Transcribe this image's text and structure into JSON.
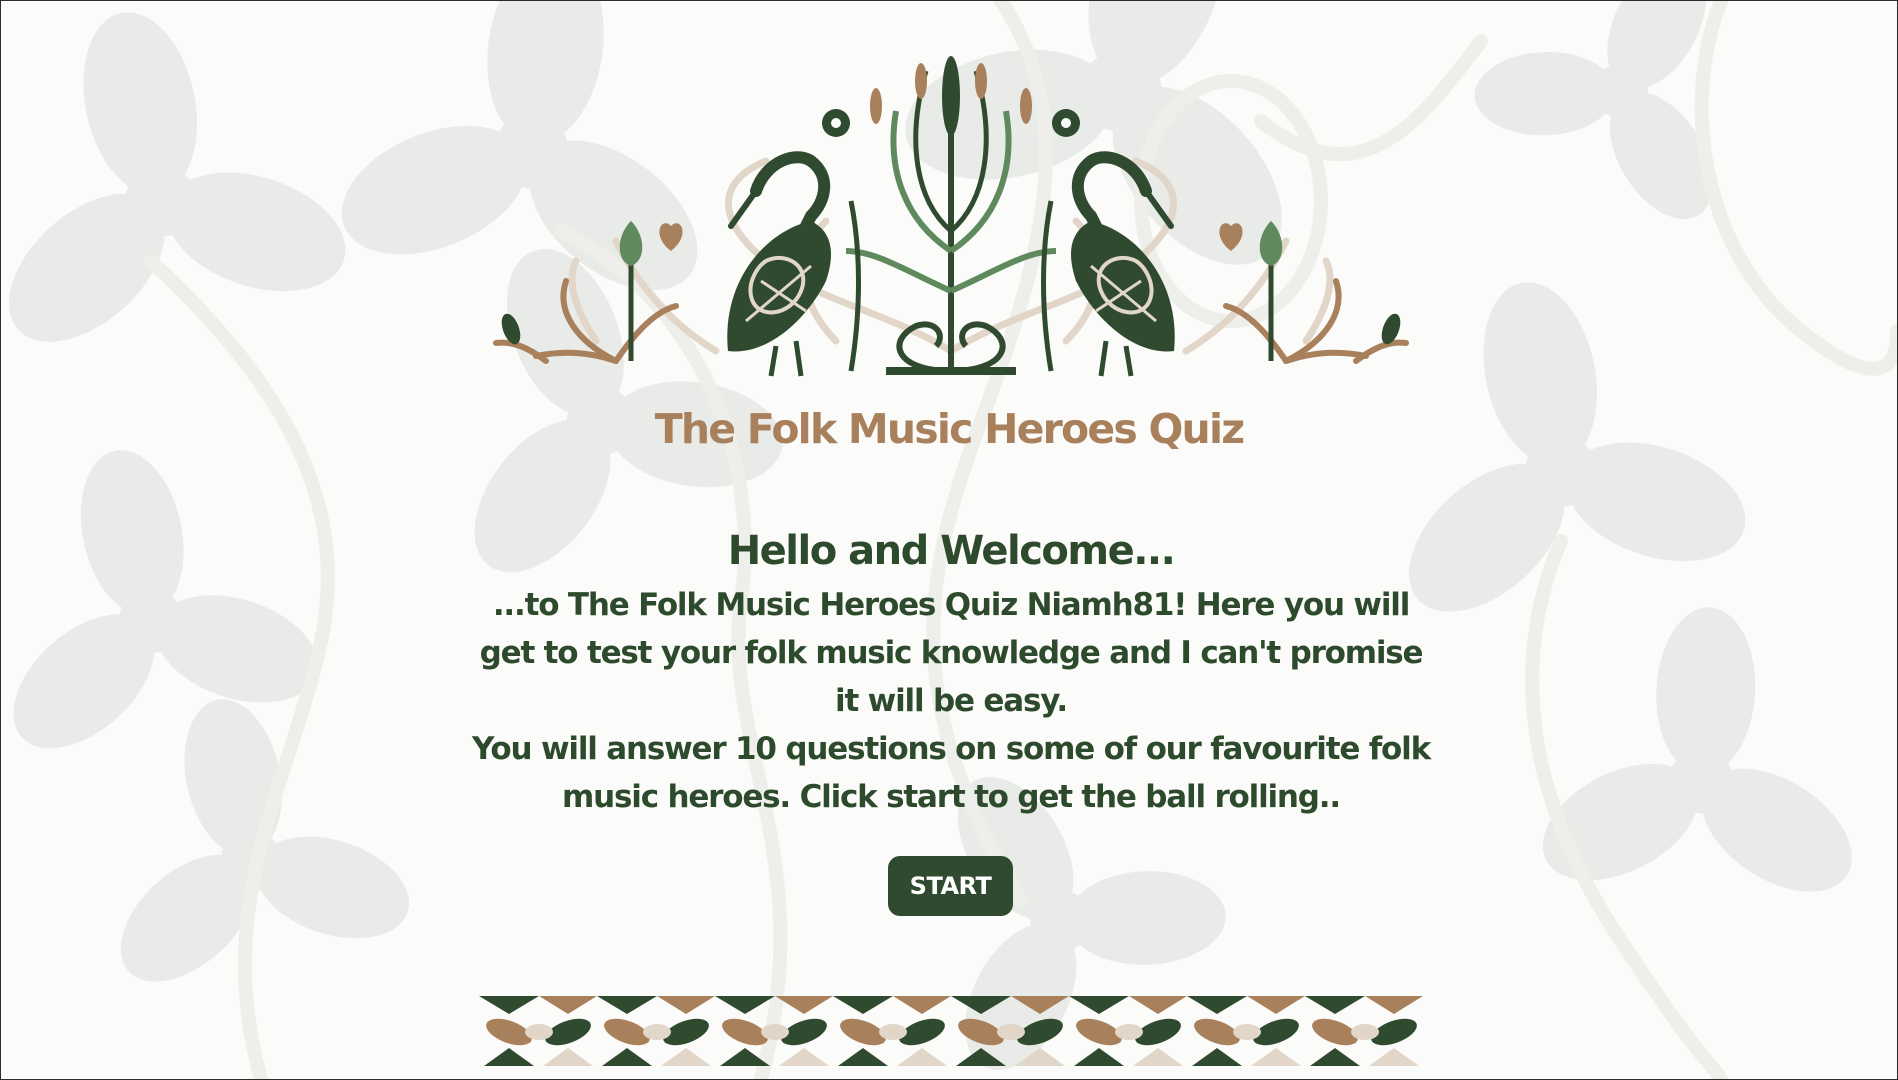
{
  "header": {
    "title": "The Folk Music Heroes Quiz"
  },
  "welcome": {
    "heading": "Hello and Welcome...",
    "intro": "...to The Folk Music Heroes Quiz Niamh81! Here you will get to test your folk music knowledge and I can't promise it will be easy.",
    "instructions": "You will answer 10 questions on some of our favourite folk music heroes. Click start to get the ball rolling.."
  },
  "actions": {
    "start_label": "START"
  },
  "colors": {
    "dark_green": "#2f4a2e",
    "tan": "#a9805c",
    "sage": "#5e8a5e",
    "cream": "#e1d6c8",
    "background_pattern": "#e9ece8"
  },
  "icons": {
    "background": "shamrock-pattern",
    "header": "heron-folk-art-decoration",
    "footer": "folk-border-decoration"
  }
}
